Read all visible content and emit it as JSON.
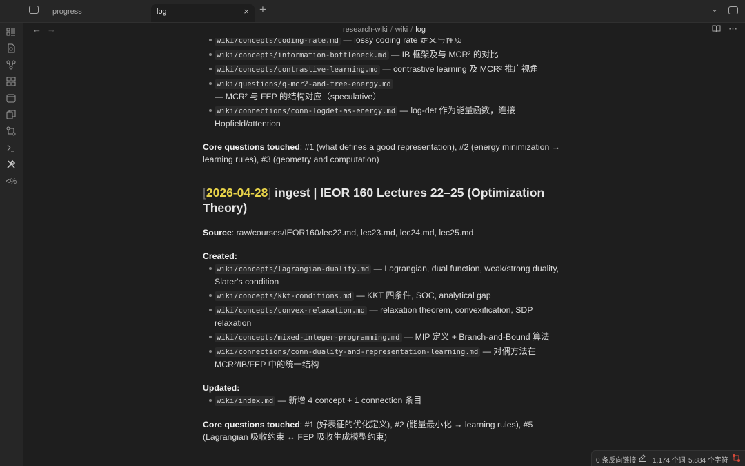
{
  "tabs": {
    "progress": "progress",
    "log": "log",
    "close": "×",
    "new": "+"
  },
  "breadcrumb": {
    "vault": "research-wiki",
    "sep": "/",
    "folder": "wiki",
    "file": "log"
  },
  "prev_entry": {
    "items": [
      {
        "code": "wiki/concepts/coding-rate.md",
        "text": " — lossy coding rate 定义与性质"
      },
      {
        "code": "wiki/concepts/information-bottleneck.md",
        "text": " — IB 框架及与 MCR² 的对比"
      },
      {
        "code": "wiki/concepts/contrastive-learning.md",
        "text": " — contrastive learning 及 MCR² 推广视角"
      },
      {
        "code": "wiki/questions/q-mcr2-and-free-energy.md",
        "text": " — MCR² 与 FEP 的结构对应（speculative）"
      },
      {
        "code": "wiki/connections/conn-logdet-as-energy.md",
        "text": " — log-det 作为能量函数，连接 Hopfield/attention"
      }
    ],
    "core_label": "Core questions touched",
    "core_text": ": #1 (what defines a good representation), #2 (energy minimization → learning rules), #3 (geometry and computation)"
  },
  "entry": {
    "bracket_open": "[",
    "date": "2026-04-28",
    "bracket_close": "]",
    "title": " ingest | IEOR 160 Lectures 22–25 (Optimization Theory)",
    "source_label": "Source",
    "source_text": ": raw/courses/IEOR160/lec22.md, lec23.md, lec24.md, lec25.md",
    "created_label": "Created",
    "created_items": [
      {
        "code": "wiki/concepts/lagrangian-duality.md",
        "text": " — Lagrangian, dual function, weak/strong duality, Slater's condition"
      },
      {
        "code": "wiki/concepts/kkt-conditions.md",
        "text": " — KKT 四条件, SOC, analytical gap"
      },
      {
        "code": "wiki/concepts/convex-relaxation.md",
        "text": " — relaxation theorem, convexification, SDP relaxation"
      },
      {
        "code": "wiki/concepts/mixed-integer-programming.md",
        "text": " — MIP 定义 + Branch-and-Bound 算法"
      },
      {
        "code": "wiki/connections/conn-duality-and-representation-learning.md",
        "text": " — 对偶方法在 MCR²/IB/FEP 中的统一结构"
      }
    ],
    "updated_label": "Updated",
    "updated_items": [
      {
        "code": "wiki/index.md",
        "text": " — 新增 4 concept + 1 connection 条目"
      }
    ],
    "core_label": "Core questions touched",
    "core_text": ": #1 (好表征的优化定义), #2 (能量最小化 → learning rules), #5 (Lagrangian 吸收约束 ↔ FEP 吸收生成模型约束)"
  },
  "status": {
    "backlinks": "0 条反向链接",
    "words": "1,174 个词",
    "chars": "5,884 个字符"
  },
  "icons": {
    "ribbon": [
      "files-icon",
      "search-icon",
      "graph-icon",
      "canvas-icon",
      "calendar-icon",
      "copy-icon",
      "sync-icon",
      "terminal-icon",
      "tools-icon",
      "percent-icon"
    ]
  },
  "accent": "#e8d349"
}
